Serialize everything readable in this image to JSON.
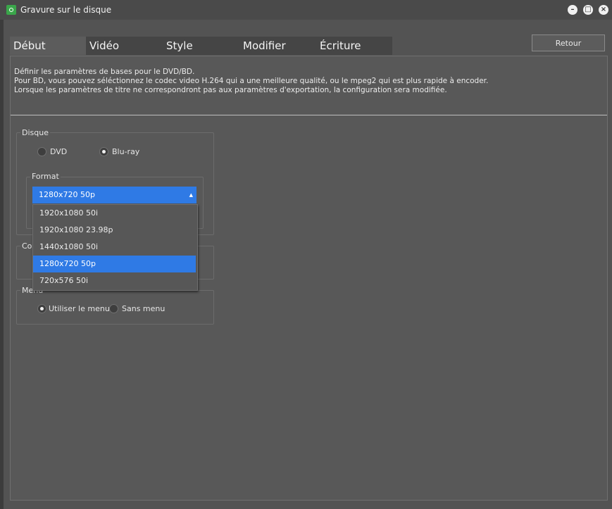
{
  "window": {
    "title": "Gravure sur le disque"
  },
  "tabs": [
    "Début",
    "Vidéo",
    "Style",
    "Modifier",
    "Écriture"
  ],
  "back_button": "Retour",
  "description": [
    "Définir les paramètres de bases pour le DVD/BD.",
    "Pour BD, vous pouvez séléctionnez le codec video H.264 qui a une meilleure qualité, ou le mpeg2 qui est plus rapide à encoder.",
    "Lorsque les paramètres de titre ne correspondront pas aux paramètres d'exportation, la configuration sera modifiée."
  ],
  "disc": {
    "label": "Disque",
    "dvd": "DVD",
    "bluray": "Blu-ray",
    "selected": "Blu-ray"
  },
  "format": {
    "label": "Format",
    "value": "1280x720 50p",
    "options": [
      "1920x1080 50i",
      "1920x1080 23.98p",
      "1440x1080 50i",
      "1280x720 50p",
      "720x576 50i"
    ],
    "selected_index": 3
  },
  "codec": {
    "label": "Co"
  },
  "menu": {
    "label": "Menu",
    "use_menu": "Utiliser le menu",
    "no_menu": "Sans menu",
    "selected": "Utiliser le menu"
  }
}
